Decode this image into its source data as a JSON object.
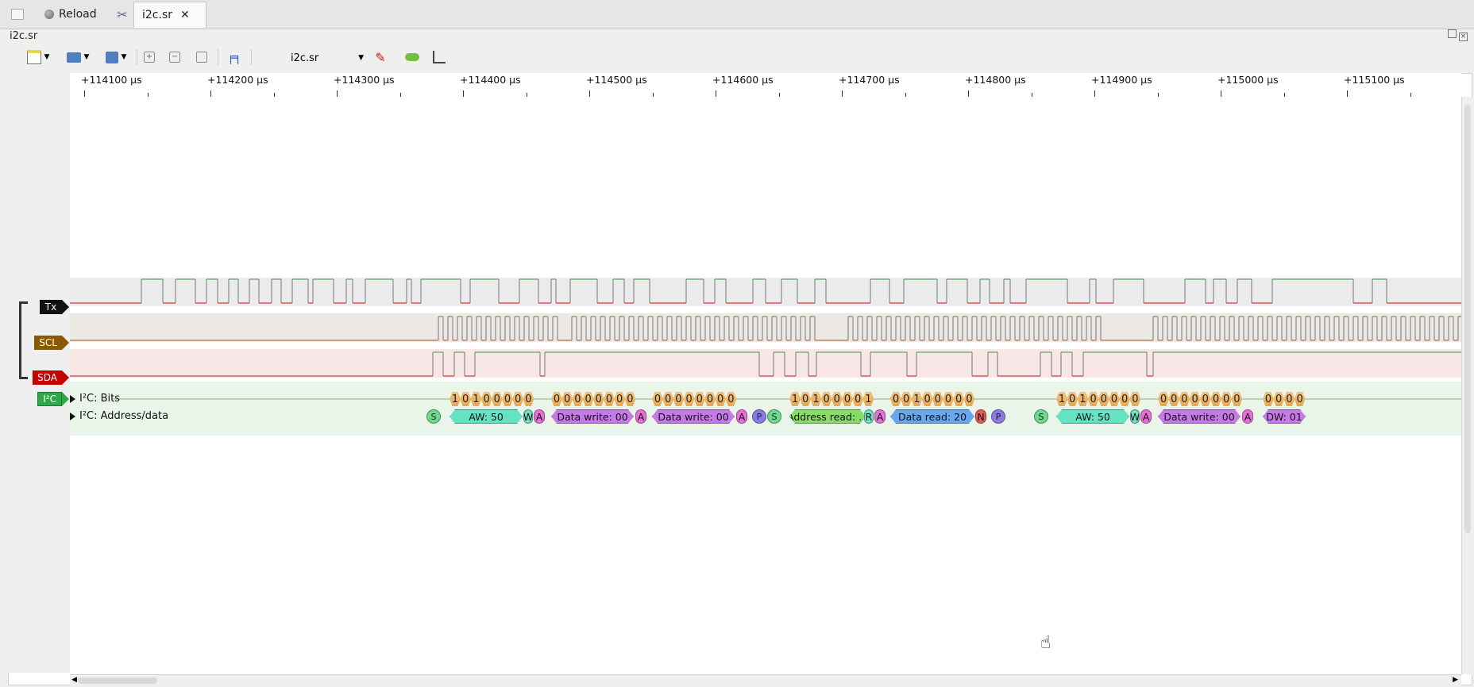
{
  "tabs": [
    {
      "label": ""
    },
    {
      "label": "Reload"
    },
    {
      "label": ""
    },
    {
      "label": "i2c.sr"
    }
  ],
  "document_title": "i2c.sr",
  "toolbar": {
    "device_select": "i2c.sr"
  },
  "ruler": {
    "labels": [
      "+114100 µs",
      "+114200 µs",
      "+114300 µs",
      "+114400 µs",
      "+114500 µs",
      "+114600 µs",
      "+114700 µs",
      "+114800 µs",
      "+114900 µs",
      "+115000 µs",
      "+115100 µs"
    ]
  },
  "channels": [
    {
      "name": "Tx",
      "color": "#111111"
    },
    {
      "name": "SCL",
      "color": "#8a5a00"
    },
    {
      "name": "SDA",
      "color": "#c40000"
    }
  ],
  "decoder": {
    "name": "I²C",
    "color": "#2fa84a",
    "rows": [
      "I²C: Bits",
      "I²C: Address/data"
    ]
  },
  "bits_groups": [
    [
      "1",
      "0",
      "1",
      "0",
      "0",
      "0",
      "0",
      "0"
    ],
    [
      "0",
      "0",
      "0",
      "0",
      "0",
      "0",
      "0",
      "0"
    ],
    [
      "0",
      "0",
      "0",
      "0",
      "0",
      "0",
      "0",
      "0"
    ],
    [
      "1",
      "0",
      "1",
      "0",
      "0",
      "0",
      "0",
      "1"
    ],
    [
      "0",
      "0",
      "1",
      "0",
      "0",
      "0",
      "0",
      "0"
    ],
    [
      "1",
      "0",
      "1",
      "0",
      "0",
      "0",
      "0",
      "0"
    ],
    [
      "0",
      "0",
      "0",
      "0",
      "0",
      "0",
      "0",
      "0"
    ],
    [
      "0",
      "0",
      "0",
      "0"
    ]
  ],
  "annotations": [
    {
      "text": "S",
      "kind": "start"
    },
    {
      "text": "AW: 50",
      "kind": "addr-write"
    },
    {
      "text": "W",
      "kind": "rw"
    },
    {
      "text": "A",
      "kind": "ack"
    },
    {
      "text": "Data write: 00",
      "kind": "data-write"
    },
    {
      "text": "A",
      "kind": "ack"
    },
    {
      "text": "Data write: 00",
      "kind": "data-write"
    },
    {
      "text": "A",
      "kind": "ack"
    },
    {
      "text": "P",
      "kind": "stop"
    },
    {
      "text": "S",
      "kind": "start"
    },
    {
      "text": "Address read: ...",
      "kind": "addr-read"
    },
    {
      "text": "R",
      "kind": "rw"
    },
    {
      "text": "A",
      "kind": "ack"
    },
    {
      "text": "Data read: 20",
      "kind": "data-read"
    },
    {
      "text": "N",
      "kind": "nack"
    },
    {
      "text": "P",
      "kind": "stop"
    },
    {
      "text": "S",
      "kind": "start"
    },
    {
      "text": "AW: 50",
      "kind": "addr-write"
    },
    {
      "text": "W",
      "kind": "rw"
    },
    {
      "text": "A",
      "kind": "ack"
    },
    {
      "text": "Data write: 00",
      "kind": "data-write"
    },
    {
      "text": "A",
      "kind": "ack"
    },
    {
      "text": "DW: 01",
      "kind": "data-write"
    }
  ]
}
